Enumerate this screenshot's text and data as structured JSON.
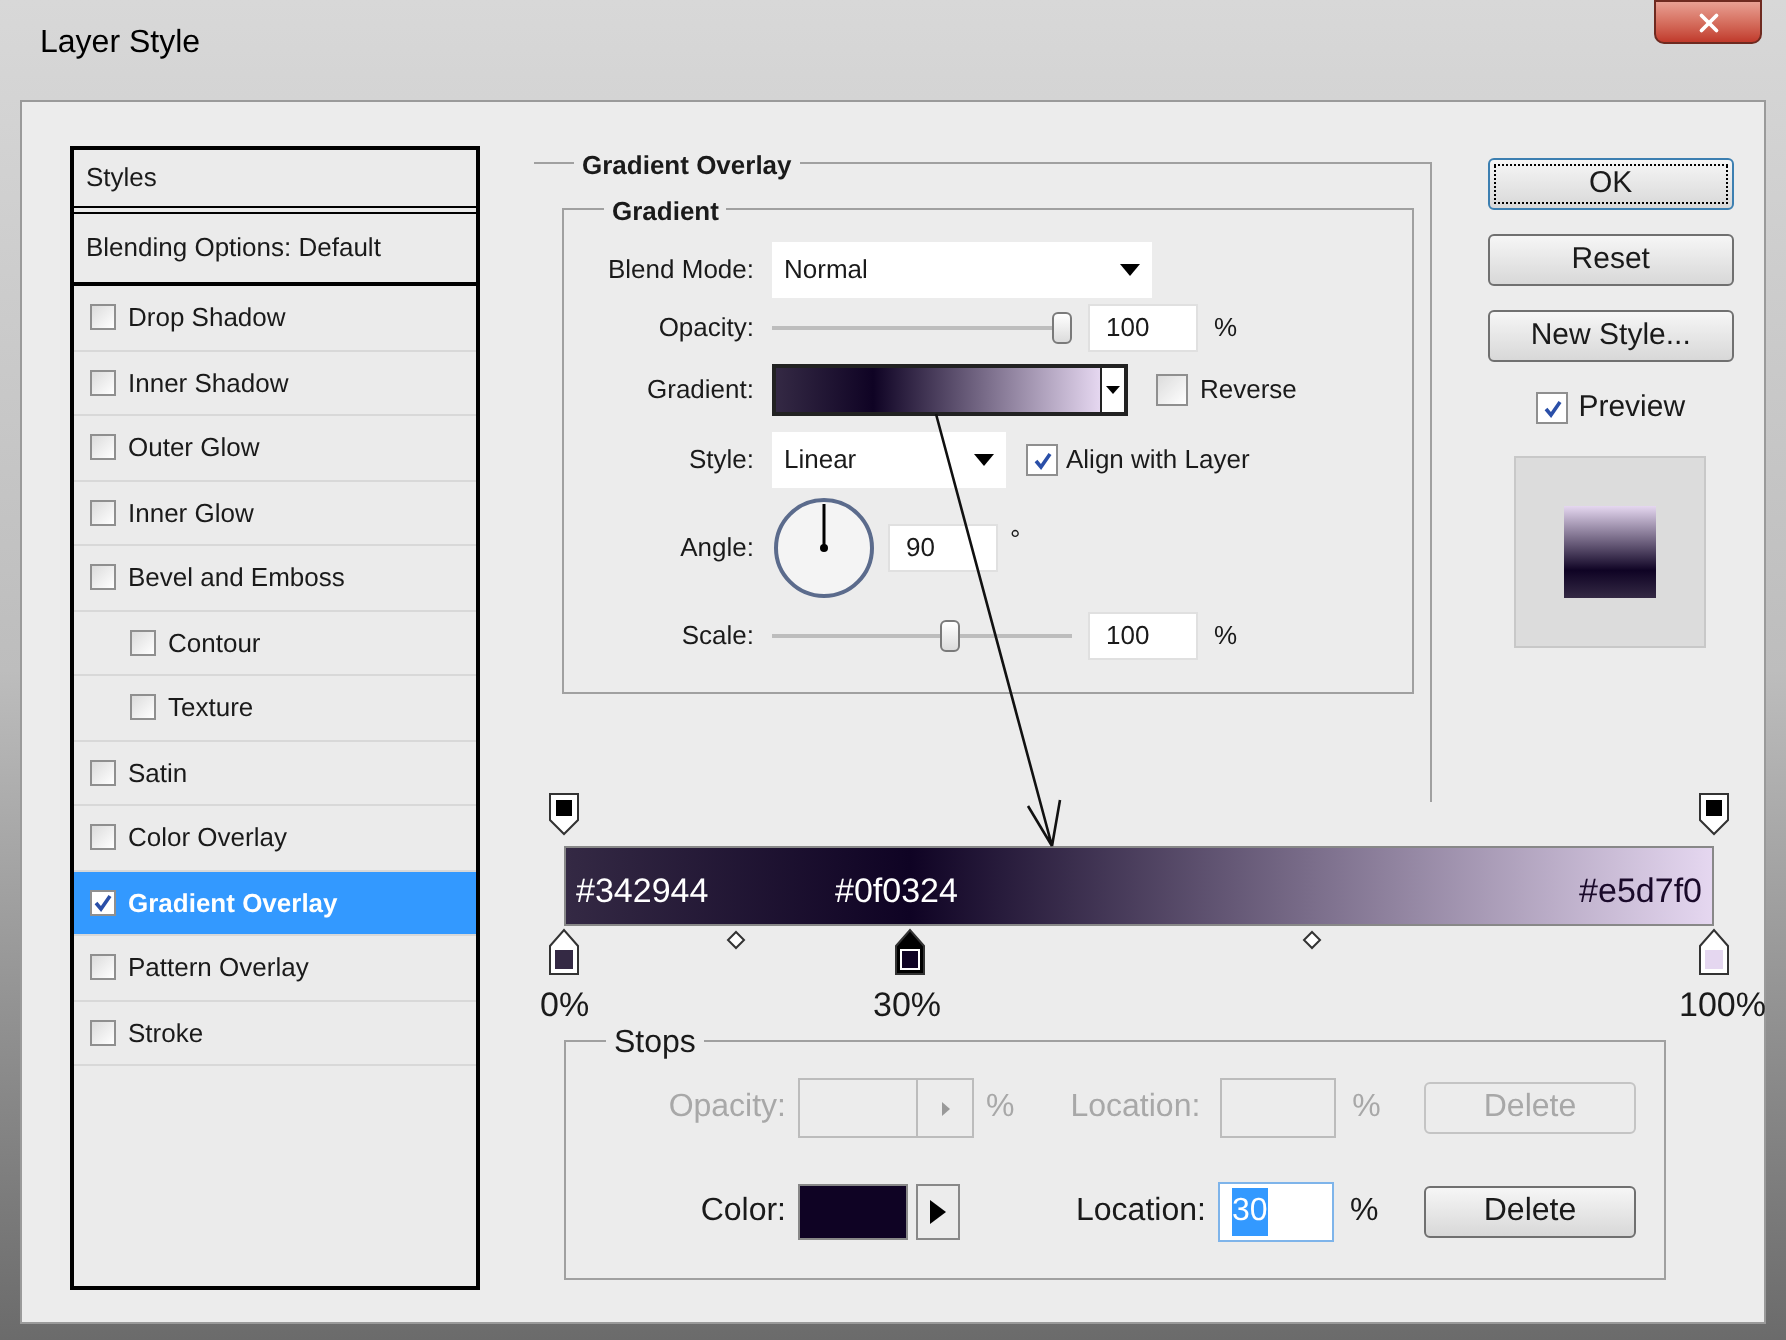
{
  "window": {
    "title": "Layer Style"
  },
  "styles_panel": {
    "header": "Styles",
    "blending": "Blending Options: Default",
    "items": [
      {
        "label": "Drop Shadow",
        "checked": false,
        "selected": false
      },
      {
        "label": "Inner Shadow",
        "checked": false,
        "selected": false
      },
      {
        "label": "Outer Glow",
        "checked": false,
        "selected": false
      },
      {
        "label": "Inner Glow",
        "checked": false,
        "selected": false
      },
      {
        "label": "Bevel and Emboss",
        "checked": false,
        "selected": false,
        "children": [
          {
            "label": "Contour",
            "checked": false,
            "selected": false
          },
          {
            "label": "Texture",
            "checked": false,
            "selected": false
          }
        ]
      },
      {
        "label": "Satin",
        "checked": false,
        "selected": false
      },
      {
        "label": "Color Overlay",
        "checked": false,
        "selected": false
      },
      {
        "label": "Gradient Overlay",
        "checked": true,
        "selected": true
      },
      {
        "label": "Pattern Overlay",
        "checked": false,
        "selected": false
      },
      {
        "label": "Stroke",
        "checked": false,
        "selected": false
      }
    ]
  },
  "gradient_overlay": {
    "title": "Gradient Overlay",
    "group": "Gradient",
    "blend_mode": {
      "label": "Blend Mode:",
      "value": "Normal"
    },
    "opacity": {
      "label": "Opacity:",
      "level": 1,
      "value": "100",
      "unit": "%"
    },
    "gradient": {
      "label": "Gradient:"
    },
    "reverse": {
      "label": "Reverse",
      "checked": false
    },
    "style": {
      "label": "Style:",
      "value": "Linear"
    },
    "align": {
      "label": "Align with Layer",
      "checked": true
    },
    "angle": {
      "label": "Angle:",
      "value": "90",
      "unit": "°"
    },
    "scale": {
      "label": "Scale:",
      "level": 0.6,
      "value": "100",
      "unit": "%"
    }
  },
  "gradient_editor": {
    "color_stops": [
      {
        "label": "0%",
        "color": "#342944",
        "annotation": "#342944",
        "selected": false
      },
      {
        "label": "30%",
        "color": "#0f0324",
        "annotation": "#0f0324",
        "selected": true
      },
      {
        "label": "100%",
        "color": "#e5d7f0",
        "annotation": "#e5d7f0",
        "selected": false
      }
    ]
  },
  "stops": {
    "title": "Stops",
    "opacity_row": {
      "disabled": true,
      "label": "Opacity:",
      "unit": "%",
      "location_label": "Location:",
      "location_unit": "%",
      "delete": "Delete"
    },
    "color_row": {
      "disabled": false,
      "label": "Color:",
      "color": "#0f0324",
      "location_label": "Location:",
      "location_value": "30",
      "location_unit": "%",
      "delete": "Delete"
    }
  },
  "buttons": [
    {
      "label": "OK"
    },
    {
      "label": "Reset"
    },
    {
      "label": "New Style..."
    }
  ],
  "preview": {
    "label": "Preview",
    "checked": true
  }
}
